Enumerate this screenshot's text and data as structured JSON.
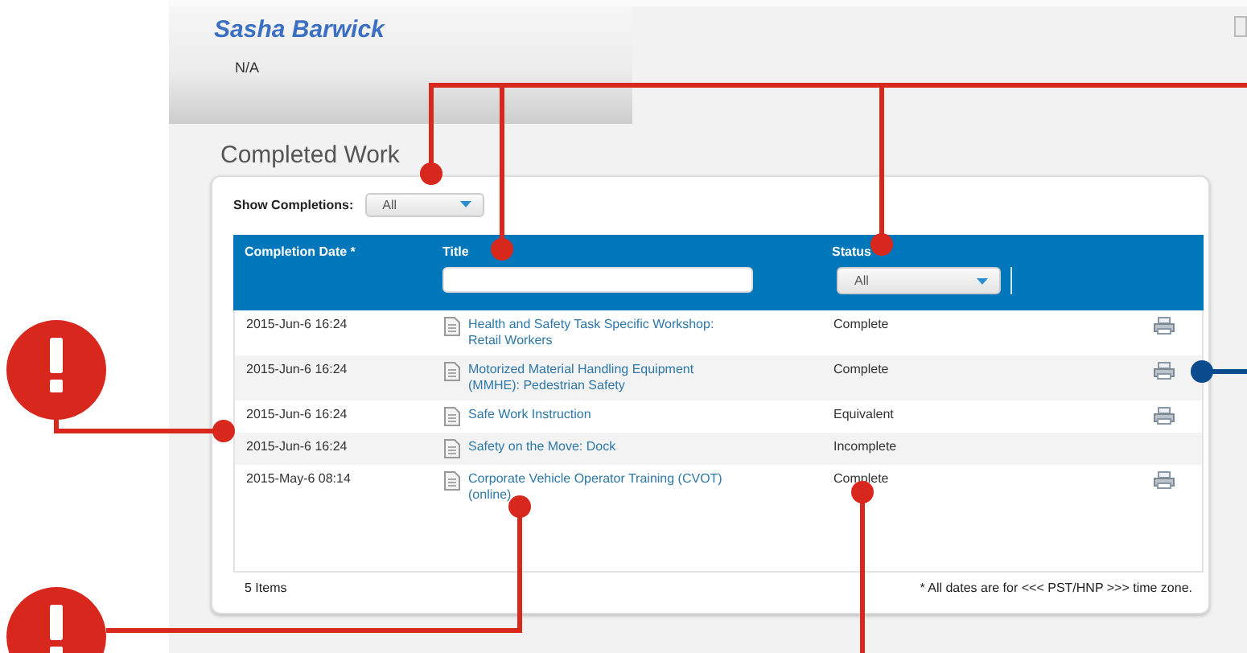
{
  "profile": {
    "name": "Sasha Barwick",
    "subtitle": "N/A"
  },
  "section_title": "Completed Work",
  "filter": {
    "label": "Show Completions:",
    "value": "All"
  },
  "table": {
    "columns": [
      {
        "label": "Completion Date *",
        "filter": {
          "kind": "none"
        }
      },
      {
        "label": "Title",
        "filter": {
          "kind": "text"
        }
      },
      {
        "label": "Status",
        "filter": {
          "kind": "select",
          "value": "All"
        }
      }
    ],
    "rows": [
      {
        "date": "2015-Jun-6 16:24",
        "title": "Health and Safety Task Specific Workshop: Retail Workers",
        "status": "Complete",
        "printable": true
      },
      {
        "date": "2015-Jun-6 16:24",
        "title": "Motorized Material Handling Equipment (MMHE): Pedestrian Safety",
        "status": "Complete",
        "printable": true
      },
      {
        "date": "2015-Jun-6 16:24",
        "title": "Safe Work Instruction",
        "status": "Equivalent",
        "printable": true
      },
      {
        "date": "2015-Jun-6 16:24",
        "title": "Safety on the Move: Dock",
        "status": "Incomplete",
        "printable": false
      },
      {
        "date": "2015-May-6 08:14",
        "title": "Corporate Vehicle Operator Training (CVOT) (online)",
        "status": "Complete",
        "printable": true
      }
    ]
  },
  "footer": {
    "count": "5 Items",
    "note": "* All dates are for <<< PST/HNP >>> time zone."
  }
}
